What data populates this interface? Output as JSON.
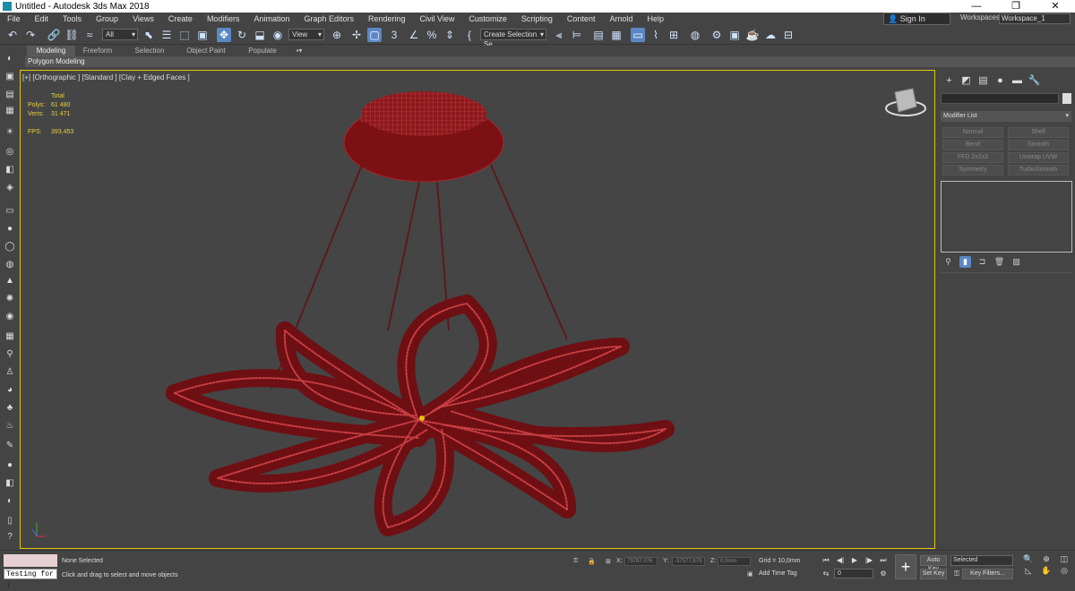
{
  "window": {
    "title": "Untitled - Autodesk 3ds Max 2018",
    "minimize": "—",
    "restore": "❐",
    "close": "✕"
  },
  "menu": [
    "File",
    "Edit",
    "Tools",
    "Group",
    "Views",
    "Create",
    "Modifiers",
    "Animation",
    "Graph Editors",
    "Rendering",
    "Civil View",
    "Customize",
    "Scripting",
    "Content",
    "Arnold",
    "Help"
  ],
  "account": {
    "signin": "Sign In",
    "workspaces_label": "Workspaces:",
    "workspace": "Workspace_1"
  },
  "toolbar": {
    "filter": "All",
    "view_dropdown": "View",
    "selection_set": "Create Selection Se"
  },
  "ribbon": {
    "tabs": [
      "Modeling",
      "Freeform",
      "Selection",
      "Object Paint",
      "Populate"
    ],
    "active_tab": "Modeling",
    "sub": "Polygon Modeling"
  },
  "viewport": {
    "label": "[+] [Orthographic ] [Standard ] [Clay + Edged Faces ]",
    "stats": {
      "header": "Total",
      "polys_label": "Polys:",
      "polys": "61 480",
      "verts_label": "Verts:",
      "verts": "31 471",
      "fps_label": "FPS:",
      "fps": "393,453"
    },
    "mesh_color": "#8b1a1e",
    "wire_color": "#e04c50"
  },
  "command_panel": {
    "modifier_list": "Modifier List",
    "buttons": [
      "Normal",
      "Shell",
      "Bend",
      "Smooth",
      "FFD 2x2x2",
      "Unwrap UVW",
      "Symmetry",
      "TurboSmooth"
    ]
  },
  "status": {
    "selection": "None Selected",
    "prompt": "Click and drag to select and move objects",
    "maxscript": "Testing for ↓",
    "x_label": "X:",
    "x": "79787,076",
    "y_label": "Y:",
    "y": "-37577,879",
    "z_label": "Z:",
    "z": "0,0mm",
    "grid": "Grid = 10,0mm",
    "add_time_tag": "Add Time Tag",
    "frame": "0",
    "auto_key": "Auto Key",
    "set_key": "Set Key",
    "selected": "Selected",
    "key_filters": "Key Filters..."
  }
}
